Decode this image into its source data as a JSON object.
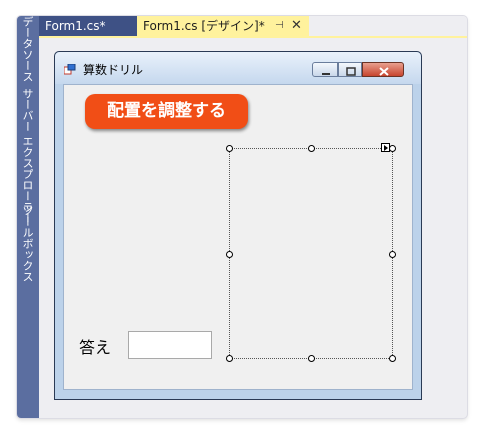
{
  "side_panel": {
    "items": [
      {
        "label": "データソース"
      },
      {
        "label": "サーバー エクスプローラー"
      },
      {
        "label": "ツールボックス"
      }
    ]
  },
  "tabs": [
    {
      "label": "Form1.cs*",
      "active": false
    },
    {
      "label": "Form1.cs [デザイン]*",
      "active": true
    }
  ],
  "tab_controls": {
    "pin_glyph": "⊣",
    "close_glyph": "✕"
  },
  "form": {
    "title": "算数ドリル",
    "button_label": "配置を調整する",
    "answer_label": "答え",
    "answer_value": ""
  },
  "colors": {
    "button": "#f14e16",
    "active_tab": "#fff29d",
    "side_rail": "#5b6ea0"
  }
}
